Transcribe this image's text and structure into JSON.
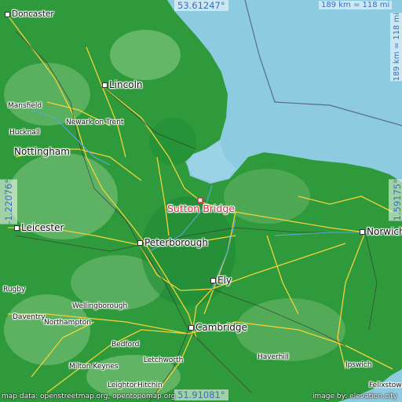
{
  "map": {
    "target_label": "Sutton Bridge",
    "coords": {
      "north": "53.61247°",
      "south": "51.91081°",
      "west": "-1.22076°",
      "east": "1.59175°"
    },
    "scale_label": "189 km = 118 mi",
    "attribution_left": "map data: openstreetmap.org, opentopomap.org",
    "attribution_right": "image by: elevation.city",
    "places": [
      {
        "key": "doncaster",
        "label": "Doncaster"
      },
      {
        "key": "lincoln",
        "label": "Lincoln"
      },
      {
        "key": "mansfield",
        "label": "Mansfield"
      },
      {
        "key": "hucknall",
        "label": "Hucknall"
      },
      {
        "key": "newark",
        "label": "Newark on Trent"
      },
      {
        "key": "nottingham",
        "label": "Nottingham"
      },
      {
        "key": "leicester",
        "label": "Leicester"
      },
      {
        "key": "peterborough",
        "label": "Peterborough"
      },
      {
        "key": "norwich",
        "label": "Norwich"
      },
      {
        "key": "ely",
        "label": "Ely"
      },
      {
        "key": "rugby",
        "label": "Rugby"
      },
      {
        "key": "wellingborough",
        "label": "Wellingborough"
      },
      {
        "key": "daventry",
        "label": "Daventry"
      },
      {
        "key": "northampton",
        "label": "Northampton"
      },
      {
        "key": "bedford",
        "label": "Bedford"
      },
      {
        "key": "cambridge",
        "label": "Cambridge"
      },
      {
        "key": "haverhill",
        "label": "Haverhill"
      },
      {
        "key": "ipswich",
        "label": "Ipswich"
      },
      {
        "key": "felixstowe",
        "label": "Felixstowe"
      },
      {
        "key": "milton_keynes",
        "label": "Milton Keynes"
      },
      {
        "key": "letchworth",
        "label": "Letchworth"
      },
      {
        "key": "leighton",
        "label": "Leighton"
      },
      {
        "key": "hitchin",
        "label": "Hitchin"
      }
    ]
  }
}
